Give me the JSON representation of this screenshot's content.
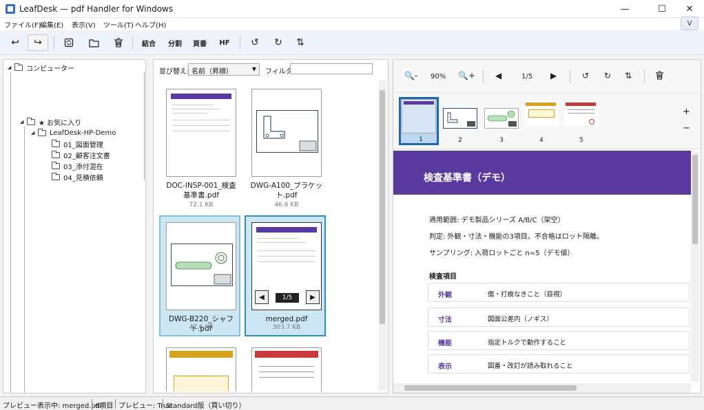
{
  "window": {
    "title": "LeafDesk — pdf Handler for Windows"
  },
  "menu": [
    {
      "label": "ファイル(F)"
    },
    {
      "label": "編集(E)"
    },
    {
      "label": "表示(V)"
    },
    {
      "label": "ツール(T)"
    },
    {
      "label": "ヘルプ(H)"
    }
  ],
  "menu_chevron": "V",
  "toolbar": {
    "undo_icon": "↩",
    "redo_icon": "↪",
    "merge": "結合",
    "split": "分割",
    "page_number": "頁番",
    "hf": "HF",
    "rotate_left_icon": "↺",
    "rotate_right_icon": "↻",
    "flip_icon": "⇅"
  },
  "tree": {
    "root": "コンピューター",
    "favorites": "★ お気に入り",
    "demo": "LeafDesk-HP-Demo",
    "folders": [
      "01_図面管理",
      "02_顧客注文書",
      "03_添付混在",
      "04_見積依頼"
    ]
  },
  "list": {
    "sort_label": "並び替え:",
    "sort_value": "名前（昇順）",
    "filter_label": "フィルタ:",
    "filter_value": "",
    "files": [
      {
        "name1": "DOC-INSP-001_検査",
        "name2": "基準書.pdf",
        "size": "72.1 KB"
      },
      {
        "name1": "DWG-A100_ブラケッ",
        "name2": "ト.pdf",
        "size": "46.6 KB"
      },
      {
        "name1": "DWG-B220_シャフト.pdf",
        "name2": "",
        "size": "47.6 KB"
      },
      {
        "name1": "merged.pdf",
        "name2": "",
        "size": "303.7 KB"
      }
    ],
    "merged_page": "1/5",
    "prev_icon": "◀",
    "next_icon": "▶"
  },
  "preview": {
    "zoom_out_icon": "🔍-",
    "zoom_level": "90%",
    "zoom_in_icon": "🔍+",
    "prev_icon": "◀",
    "page_indicator": "1/5",
    "next_icon": "▶",
    "rotate_left_icon": "↺",
    "rotate_right_icon": "↻",
    "flip_icon": "⇅",
    "plus": "+",
    "minus": "−",
    "thumbnails": [
      "1",
      "2",
      "3",
      "4",
      "5"
    ]
  },
  "page": {
    "title": "検査基準書（デモ）",
    "lines": [
      "適用範囲: デモ製品シリーズ A/B/C（架空）",
      "判定: 外観・寸法・機能の3項目。不合格はロット隔離。",
      "サンプリング: 入荷ロットごと n=5（デモ値）"
    ],
    "section": "検査項目",
    "rows": [
      {
        "key": "外観",
        "val": "傷・打痕なきこと（目視）"
      },
      {
        "key": "寸法",
        "val": "図面公差内（ノギス）"
      },
      {
        "key": "機能",
        "val": "指定トルクで動作すること"
      },
      {
        "key": "表示",
        "val": "図番・改訂が読み取れること"
      }
    ]
  },
  "status": {
    "previewing": "プレビュー表示中: merged.pdf",
    "count": "6項目",
    "preview_flag": "プレビュー: True",
    "edition": "Standard版（買い切り）"
  },
  "colors": {
    "accent": "#5b3aa0",
    "selection": "#cce6f3",
    "active": "#1e66b8"
  }
}
